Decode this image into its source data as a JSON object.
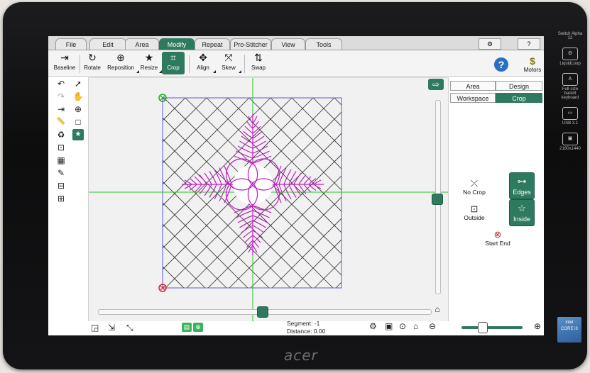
{
  "menu": {
    "tabs": [
      {
        "label": "File"
      },
      {
        "label": "Edit"
      },
      {
        "label": "Area"
      },
      {
        "label": "Modify"
      },
      {
        "label": "Repeat"
      },
      {
        "label": "Pro-Stitcher"
      },
      {
        "label": "View"
      },
      {
        "label": "Tools"
      }
    ],
    "active_tab": "Modify",
    "right_buttons": [
      {
        "icon": "settings-icon",
        "glyph": "⚙"
      },
      {
        "icon": "question-icon",
        "glyph": "?"
      }
    ]
  },
  "toolbar": {
    "tools": [
      {
        "label": "Baseline",
        "icon": "baseline-icon",
        "glyph": "⇥"
      },
      {
        "label": "Rotate",
        "icon": "rotate-icon",
        "glyph": "↻"
      },
      {
        "label": "Reposition",
        "icon": "reposition-icon",
        "glyph": "⊕"
      },
      {
        "label": "Resize",
        "icon": "resize-icon",
        "glyph": "★"
      },
      {
        "label": "Crop",
        "icon": "crop-icon",
        "glyph": "⌗"
      },
      {
        "label": "Align",
        "icon": "align-icon",
        "glyph": "✥"
      },
      {
        "label": "Skew",
        "icon": "skew-icon",
        "glyph": "⤧"
      },
      {
        "label": "Swap",
        "icon": "swap-icon",
        "glyph": "⇅"
      }
    ],
    "active_tool": "Crop",
    "help_glyph": "?",
    "motors_label": "Motors",
    "motors_glyph": "$"
  },
  "left_tools": [
    {
      "icon": "undo-icon",
      "glyph": "↶"
    },
    {
      "icon": "pointer-icon",
      "glyph": "➚"
    },
    {
      "icon": "redo-icon",
      "glyph": "↷"
    },
    {
      "icon": "hand-icon",
      "glyph": "✋"
    },
    {
      "icon": "baseline-small-icon",
      "glyph": "⇥"
    },
    {
      "icon": "zoom-in-icon",
      "glyph": "⊕"
    },
    {
      "icon": "ruler-icon",
      "glyph": "📏"
    },
    {
      "icon": "rectangle-icon",
      "glyph": "□"
    },
    {
      "icon": "pattern-icon",
      "glyph": "♻"
    },
    {
      "icon": "star-select-icon",
      "glyph": "★"
    },
    {
      "icon": "node-edit-icon",
      "glyph": "⊡"
    },
    {
      "icon": "grid-icon",
      "glyph": "▦"
    },
    {
      "icon": "pen-icon",
      "glyph": "✎"
    },
    {
      "icon": "lock-icon",
      "glyph": "⊟"
    },
    {
      "icon": "stack-icon",
      "glyph": "⊞"
    }
  ],
  "right_panel": {
    "tabs_row1": [
      {
        "label": "Area"
      },
      {
        "label": "Design"
      }
    ],
    "tabs_row2": [
      {
        "label": "Workspace"
      },
      {
        "label": "Crop"
      }
    ],
    "active_tab": "Crop",
    "no_crop_label": "No Crop",
    "outside_label": "Outside",
    "edges_label": "Edges",
    "inside_label": "Inside",
    "start_end_label": "Start End"
  },
  "status": {
    "segment_label": "Segment: -1",
    "distance_label": "Distance: 0.00"
  },
  "colors": {
    "accent": "#2e7a5e",
    "guide_lines": "#22cc22",
    "design_stroke": "#c020c0",
    "bounds_stroke": "#5b5bd6",
    "grid_stroke": "#333333"
  },
  "device": {
    "brand": "acer",
    "badges": [
      {
        "title": "Switch Alpha 12"
      },
      {
        "title": "LiquidLoop"
      },
      {
        "title": "Full-size backlit keyboard"
      },
      {
        "title": "USB 3.1"
      },
      {
        "title": "2160x1440"
      }
    ],
    "intel_label": "intel",
    "intel_sub": "CORE i3"
  }
}
